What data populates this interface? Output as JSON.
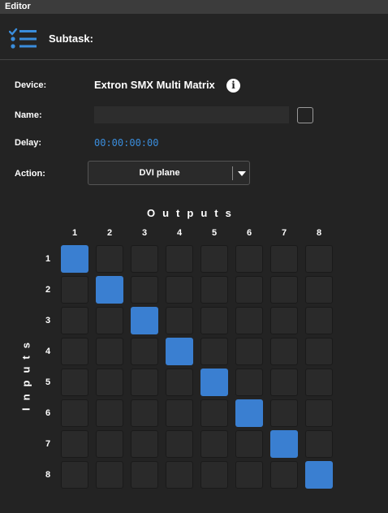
{
  "window": {
    "title": "Editor"
  },
  "header": {
    "title": "Subtask:",
    "icon": "task-list-icon"
  },
  "form": {
    "device_label": "Device:",
    "device_value": "Extron SMX Multi Matrix",
    "name_label": "Name:",
    "name_value": "",
    "delay_label": "Delay:",
    "delay_value": "00:00:00:00",
    "action_label": "Action:",
    "action_value": "DVI plane"
  },
  "matrix": {
    "outputs_title": "Outputs",
    "inputs_title": "Inputs",
    "columns": [
      "1",
      "2",
      "3",
      "4",
      "5",
      "6",
      "7",
      "8"
    ],
    "rows": [
      "1",
      "2",
      "3",
      "4",
      "5",
      "6",
      "7",
      "8"
    ],
    "active_routes": [
      [
        1,
        1
      ],
      [
        2,
        2
      ],
      [
        3,
        3
      ],
      [
        4,
        4
      ],
      [
        5,
        5
      ],
      [
        6,
        6
      ],
      [
        7,
        7
      ],
      [
        8,
        8
      ]
    ]
  },
  "colors": {
    "accent": "#3a7fd1",
    "delay_text": "#3a8ddc",
    "background": "#232323"
  }
}
